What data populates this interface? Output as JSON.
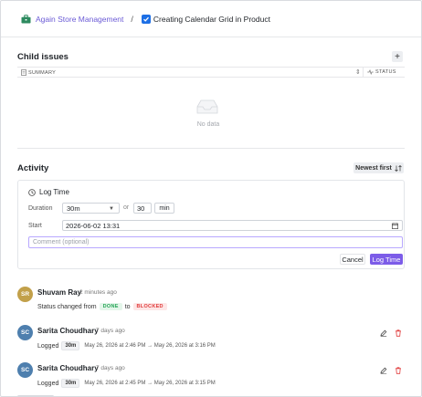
{
  "breadcrumb": {
    "project": "Again Store Management",
    "separator": "/",
    "issue_title": "Creating Calendar Grid in Product"
  },
  "child_issues": {
    "title": "Child issues",
    "add_label": "+",
    "columns": {
      "summary": "SUMMARY",
      "status": "STATUS"
    },
    "empty_text": "No data"
  },
  "activity": {
    "title": "Activity",
    "sort_label": "Newest first"
  },
  "log_time": {
    "title": "Log Time",
    "duration_label": "Duration",
    "duration_value": "30m",
    "or_text": "or",
    "minutes_value": "30",
    "unit": "min",
    "start_label": "Start",
    "start_value": "2026-06-02 13:31",
    "comment_placeholder": "Comment (optional)",
    "cancel_label": "Cancel",
    "submit_label": "Log Time"
  },
  "entries": [
    {
      "initials": "SR",
      "name": "Shuvam Ray",
      "time": "2 minutes ago",
      "color": "#c2a04a",
      "prefix": "Status changed from",
      "from_status": "DONE",
      "to_text": "to",
      "to_status": "BLOCKED"
    },
    {
      "initials": "SC",
      "name": "Sarita Choudhary",
      "time": "7 days ago",
      "color": "#4e7fae",
      "prefix": "Logged",
      "duration": "30m",
      "range": "May 26, 2026 at 2:46 PM → May 26, 2026 at 3:16 PM"
    },
    {
      "initials": "SC",
      "name": "Sarita Choudhary",
      "time": "7 days ago",
      "color": "#4e7fae",
      "prefix": "Logged",
      "duration": "30m",
      "range": "May 26, 2026 at 2:45 PM → May 26, 2026 at 3:15 PM"
    }
  ],
  "colors": {
    "accent": "#7c5ce8",
    "link": "#6b5bd6",
    "checkbox": "#1d6fe5",
    "delete": "#e03b3b"
  }
}
